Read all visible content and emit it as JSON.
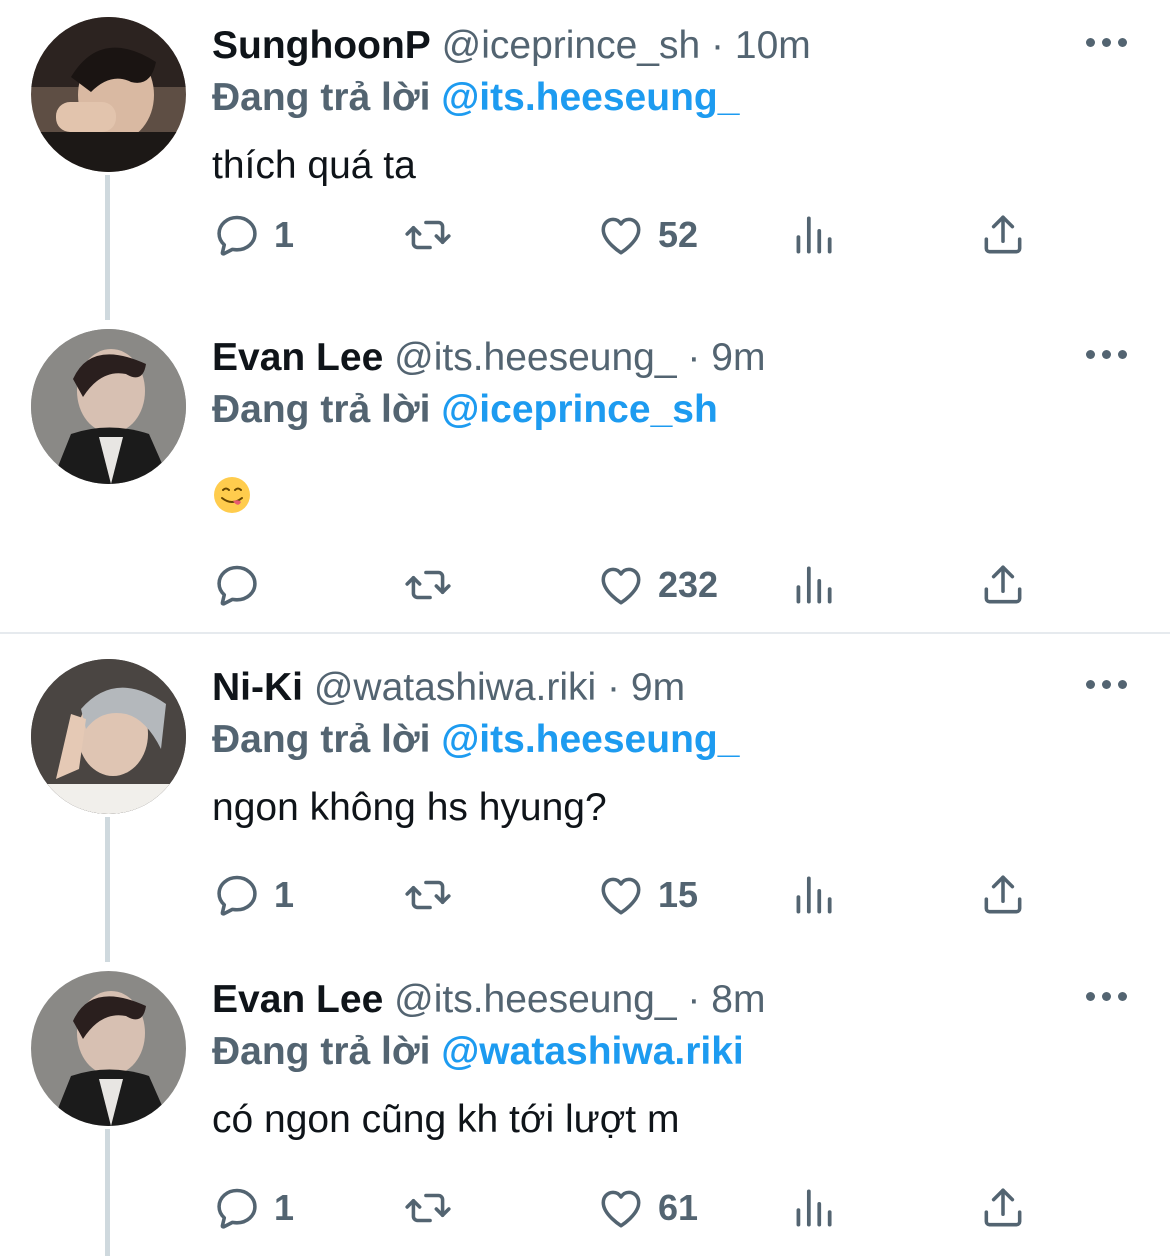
{
  "tweets": [
    {
      "name": "SunghoonP",
      "handle": "@iceprince_sh",
      "separator": "·",
      "time": "10m",
      "replying_label": "Đang trả lời",
      "replying_to": "@its.heeseung_",
      "text": "thích quá ta",
      "reply_count": "1",
      "like_count": "52",
      "avatar": "sunghoon-avatar"
    },
    {
      "name": "Evan Lee",
      "handle": "@its.heeseung_",
      "separator": "·",
      "time": "9m",
      "replying_label": "Đang trả lời",
      "replying_to": "@iceprince_sh",
      "text": "",
      "emoji": "yum-face-emoji",
      "reply_count": "",
      "like_count": "232",
      "avatar": "evan-avatar"
    },
    {
      "name": "Ni-Ki",
      "handle": "@watashiwa.riki",
      "separator": "·",
      "time": "9m",
      "replying_label": "Đang trả lời",
      "replying_to": "@its.heeseung_",
      "text": "ngon không hs hyung?",
      "reply_count": "1",
      "like_count": "15",
      "avatar": "niki-avatar"
    },
    {
      "name": "Evan Lee",
      "handle": "@its.heeseung_",
      "separator": "·",
      "time": "8m",
      "replying_label": "Đang trả lời",
      "replying_to": "@watashiwa.riki",
      "text": "có ngon cũng kh tới lượt m",
      "reply_count": "1",
      "like_count": "61",
      "avatar": "evan-avatar"
    }
  ],
  "icons": [
    "reply-icon",
    "retweet-icon",
    "like-icon",
    "views-icon",
    "share-icon",
    "more-icon"
  ],
  "colors": {
    "link": "#1d9bf0",
    "secondary": "#536471",
    "text": "#0f1419",
    "thread_line": "#cfd9de"
  }
}
